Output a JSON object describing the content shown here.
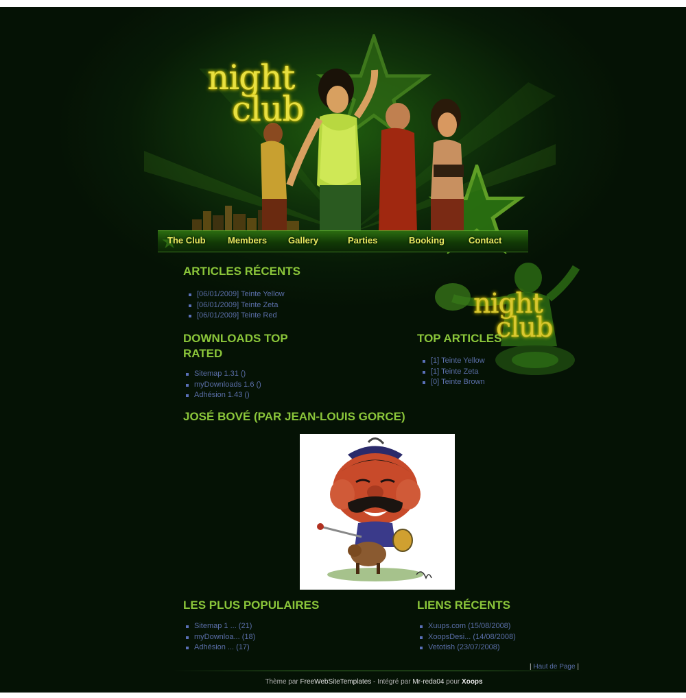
{
  "banner": {
    "logo_line1": "night",
    "logo_line2": "club"
  },
  "nav": {
    "items": [
      "The Club",
      "Members",
      "Gallery",
      "Parties",
      "Booking",
      "Contact"
    ]
  },
  "side_logo": {
    "line1": "night",
    "line2": "club"
  },
  "articles_recents": {
    "title": "ARTICLES RÉCENTS",
    "items": [
      "[06/01/2009] Teinte Yellow",
      "[06/01/2009] Teinte Zeta",
      "[06/01/2009] Teinte Red"
    ]
  },
  "downloads_top": {
    "title_line1": "DOWNLOADS TOP",
    "title_line2": "RATED",
    "items": [
      "Sitemap 1.31 ()",
      "myDownloads 1.6 ()",
      "Adhésion 1.43 ()"
    ]
  },
  "top_articles": {
    "title": "TOP ARTICLES",
    "items": [
      "[1] Teinte Yellow",
      "[1] Teinte Zeta",
      "[0] Teinte Brown"
    ]
  },
  "featured": {
    "title": "JOSÉ BOVÉ (PAR JEAN-LOUIS GORCE)"
  },
  "populaires": {
    "title": "LES PLUS POPULAIRES",
    "items": [
      "Sitemap 1 ... (21)",
      "myDownloa... (18)",
      "Adhésion ... (17)"
    ]
  },
  "liens_recents": {
    "title": "LIENS RÉCENTS",
    "items": [
      "Xuups.com (15/08/2008)",
      "XoopsDesi... (14/08/2008)",
      "Vetotish (23/07/2008)"
    ]
  },
  "footer": {
    "haut_sep_left": "|",
    "haut_label": "Haut de Page",
    "haut_sep_right": "|",
    "credits_prefix": "Thème par",
    "credits_link1": "FreeWebSiteTemplates",
    "credits_mid": " - Intégré par",
    "credits_link2": "Mr-reda04",
    "credits_mid2": "pour",
    "credits_link3": "Xoops"
  },
  "colors": {
    "background": "#071a06",
    "title_green": "#8bc63a",
    "link_blue": "#5a6ea8",
    "nav_text": "#e8e860",
    "logo_yellow": "#e8e040"
  }
}
